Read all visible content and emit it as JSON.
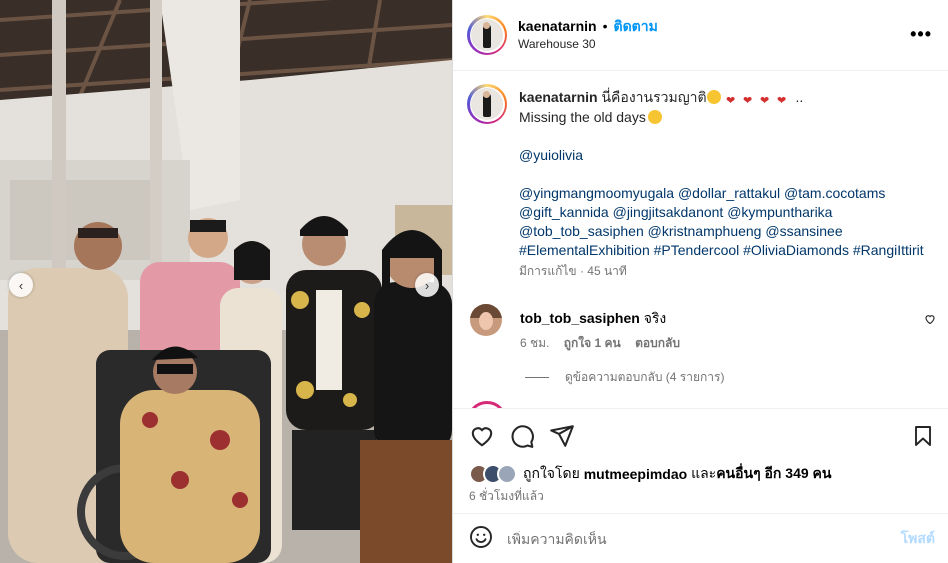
{
  "post": {
    "author": "kaenatarnin",
    "follow_label": "ติดตาม",
    "location": "Warehouse 30",
    "more_label": "•••"
  },
  "caption": {
    "username": "kaenatarnin",
    "line1_text": "นี่คืองานรวมญาติ",
    "line1_tail": "..",
    "line2": "Missing the old days",
    "mention1": "@yuiolivia",
    "line4": [
      {
        "text": "@yingmangmoomyugala",
        "type": "link"
      },
      {
        "text": " ",
        "type": "text"
      },
      {
        "text": "@dollar_rattakul",
        "type": "link"
      },
      {
        "text": " ",
        "type": "text"
      },
      {
        "text": "@tam.cocotams",
        "type": "link"
      }
    ],
    "mentions_line5": "@gift_kannida @jingjitsakdanont @kympuntharika",
    "mentions_line6": "@tob_tob_sasiphen @kristnamphueng @ssansinee",
    "hashtags": "#ElementalExhibition #PTendercool #OliviaDiamonds #RangiIttirit",
    "edited": "มีการแก้ไข",
    "edited_time": "45 นาที"
  },
  "comment": {
    "username": "tob_tob_sasiphen",
    "text": "จริง",
    "time": "6 ชม.",
    "likes": "ถูกใจ 1 คน",
    "reply_label": "ตอบกลับ",
    "view_replies": "ดูข้อความตอบกลับ (4 รายการ)"
  },
  "likes": {
    "prefix": "ถูกใจโดย",
    "user": "mutmeepimdao",
    "and": "และ",
    "others": "คนอื่นๆ อีก 349 คน"
  },
  "time_ago": "6 ชั่วโมงที่แล้ว",
  "composer": {
    "placeholder": "เพิ่มความคิดเห็น",
    "post_label": "โพสต์"
  },
  "colors": {
    "accent": "#0095f6",
    "link": "#00376b",
    "muted": "#737373"
  }
}
